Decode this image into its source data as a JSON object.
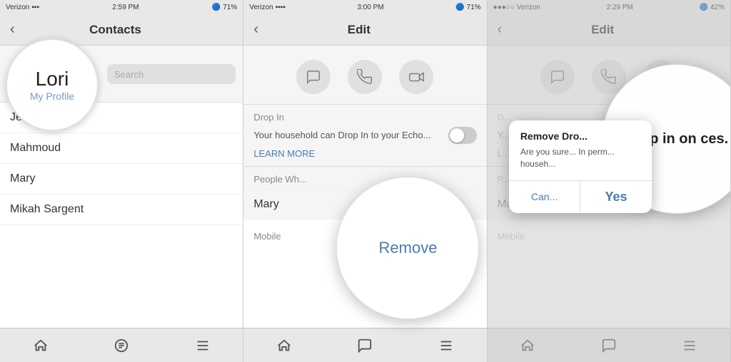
{
  "panel1": {
    "status": {
      "carrier": "Verizon",
      "time": "2:59 PM",
      "battery": "71%"
    },
    "nav": {
      "back_label": "‹",
      "title": "Contacts"
    },
    "profile": {
      "name": "Lori",
      "sub_label": "My Profile"
    },
    "contacts": [
      "Jeff",
      "Mahmoud",
      "Mary",
      "Mikah Sargent"
    ],
    "tabs": [
      "⌂",
      "💬",
      "≡"
    ]
  },
  "panel2": {
    "status": {
      "carrier": "Verizon",
      "time": "3:00 PM",
      "battery": "71%"
    },
    "nav": {
      "back_label": "‹",
      "title": "Edit"
    },
    "action_icons": [
      "💬",
      "📞",
      "📹"
    ],
    "drop_in": {
      "label": "Drop In",
      "description": "Your household can Drop In to your Echo...",
      "learn_more": "LEARN MORE"
    },
    "people_label": "People Wh...",
    "people": [
      "Mary"
    ],
    "mobile_label": "Mobile",
    "remove_label": "Remove",
    "tabs": [
      "⌂",
      "💬",
      "≡"
    ]
  },
  "panel3": {
    "status": {
      "carrier": "Verizon",
      "time": "2:29 PM",
      "battery": "42%"
    },
    "nav": {
      "back_label": "‹",
      "title": "Edit"
    },
    "action_icons": [
      "💬",
      "📞",
      "📹"
    ],
    "drop_in": {
      "label": "D...",
      "description": "Y...",
      "learn_more": "L..."
    },
    "people_label": "P...",
    "people": [
      "Mary"
    ],
    "mobile_label": "Mobile",
    "dialog": {
      "title": "Remove Dro...",
      "message": "Are you sure... In perm... househ...",
      "cancel_label": "Can...",
      "confirm_label": "Yes"
    },
    "dropin_circle_text": "Drop in on ces.",
    "tabs": [
      "⌂",
      "💬",
      "≡"
    ]
  }
}
